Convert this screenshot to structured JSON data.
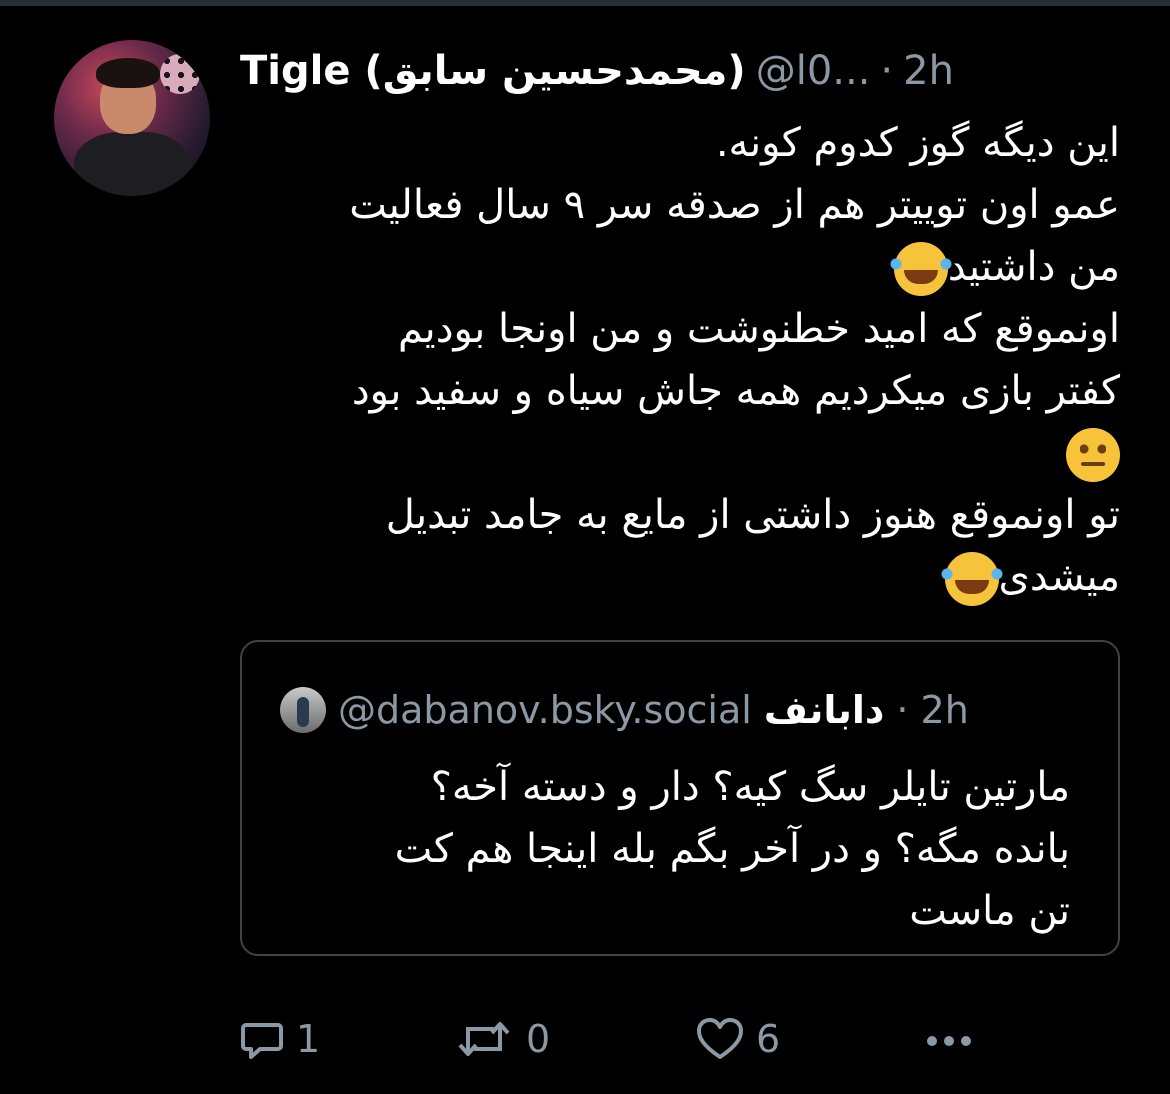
{
  "post": {
    "author_name": "Tigle (محمدحسین سابق)",
    "handle": "@l0...",
    "separator": "·",
    "time": "2h",
    "lines": [
      "این دیگه گوز کدوم کونه.",
      "عمو اون توییتر هم از صدقه سر ۹ سال فعالیت",
      "من داشتید",
      "اونموقع که امید خطنوشت و من اونجا بودیم",
      "کفتر بازی میکردیم همه جاش سیاه و سفید بود",
      "",
      "تو اونموقع هنوز داشتی از مایع به جامد تبدیل",
      "میشدی"
    ],
    "emojis": [
      "face-with-tears-of-joy-icon",
      "neutral-face-icon",
      "face-with-tears-of-joy-icon"
    ]
  },
  "quote": {
    "author_name": "دابانف",
    "handle": "@dabanov.bsky.social",
    "separator": "·",
    "time": "2h",
    "lines": [
      "مارتین تایلر سگ کیه؟ دار و دسته آخه؟",
      "بانده مگه؟ و در آخر بگم بله اینجا هم کت",
      "تن ماست"
    ]
  },
  "actions": {
    "reply_count": "1",
    "repost_count": "0",
    "like_count": "6"
  },
  "colors": {
    "background": "#000000",
    "muted_text": "#8b98a5",
    "border": "#3e4349"
  }
}
